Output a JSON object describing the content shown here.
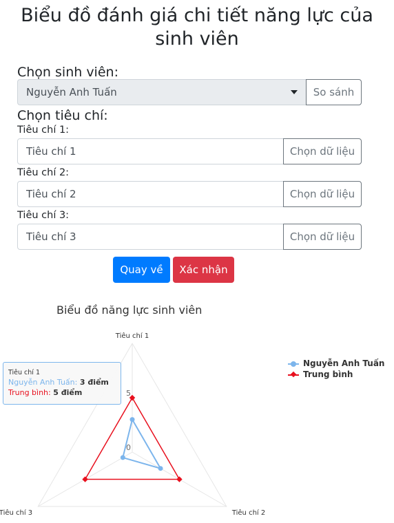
{
  "page": {
    "title": "Biểu đồ đánh giá chi tiết năng lực của sinh viên"
  },
  "student": {
    "label": "Chọn sinh viên:",
    "selected": "Nguyễn Anh Tuấn",
    "compare_button": "So sánh"
  },
  "criteria": {
    "label": "Chọn tiêu chí:",
    "fields": [
      {
        "label": "Tiêu chí 1:",
        "placeholder": "Tiêu chí 1",
        "button": "Chọn dữ liệu"
      },
      {
        "label": "Tiêu chí 2:",
        "placeholder": "Tiêu chí 2",
        "button": "Chọn dữ liệu"
      },
      {
        "label": "Tiêu chí 3:",
        "placeholder": "Tiêu chí 3",
        "button": "Chọn dữ liệu"
      }
    ]
  },
  "actions": {
    "back": "Quay về",
    "confirm": "Xác nhận"
  },
  "chart_data": {
    "type": "radar",
    "title": "Biểu đồ năng lực sinh viên",
    "categories": [
      "Tiêu chí 1",
      "Tiêu chí 2",
      "Tiêu chí 3"
    ],
    "axis_range": [
      0,
      10
    ],
    "tick_labels": [
      "0",
      "5"
    ],
    "series": [
      {
        "name": "Nguyễn Anh Tuấn",
        "values": [
          3,
          3,
          1
        ],
        "color": "#7cb5ec",
        "marker": "circle"
      },
      {
        "name": "Trung bình",
        "values": [
          5,
          5,
          5
        ],
        "color": "#e8101e",
        "marker": "diamond"
      }
    ],
    "legend_position": "top-right",
    "tooltip": {
      "header": "Tiêu chí 1",
      "rows": [
        {
          "series": "Nguyễn Anh Tuấn:",
          "value": "3 điểm"
        },
        {
          "series": "Trung bình:",
          "value": "5 điểm"
        }
      ]
    }
  }
}
